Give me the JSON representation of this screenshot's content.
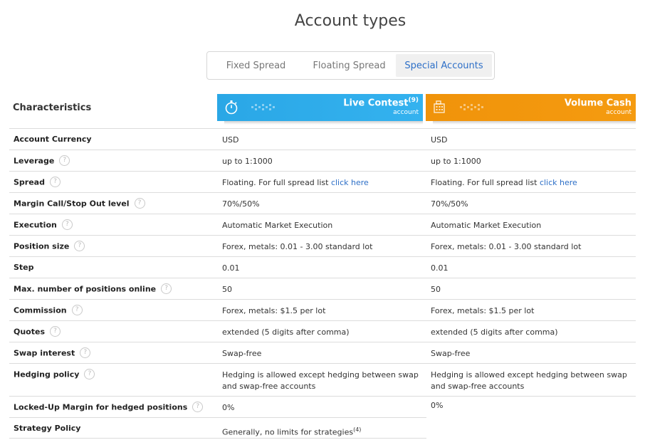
{
  "page_title": "Account types",
  "tabs": [
    {
      "label": "Fixed Spread"
    },
    {
      "label": "Floating Spread"
    },
    {
      "label": "Special Accounts"
    }
  ],
  "characteristics_title": "Characteristics",
  "accounts": [
    {
      "name": "Live Contest",
      "name_sup": "(9)",
      "subtitle": "account",
      "color": "#2aa7e6",
      "icon": "stopwatch-icon"
    },
    {
      "name": "Volume Cash",
      "name_sup": "",
      "subtitle": "account",
      "color": "#f0930a",
      "icon": "building-icon"
    }
  ],
  "rows": [
    {
      "label": "Account Currency",
      "help": false,
      "c1": "USD",
      "c2": "USD"
    },
    {
      "label": "Leverage",
      "help": true,
      "c1": "up to 1:1000",
      "c2": "up to 1:1000"
    },
    {
      "label": "Spread",
      "help": true,
      "c1": "Floating. For full spread list ",
      "c1_link": "click here",
      "c2": "Floating. For full spread list ",
      "c2_link": "click here"
    },
    {
      "label": "Margin Call/Stop Out level",
      "help": true,
      "c1": "70%/50%",
      "c2": "70%/50%"
    },
    {
      "label": "Execution",
      "help": true,
      "c1": "Automatic Market Execution",
      "c2": "Automatic Market Execution"
    },
    {
      "label": "Position size",
      "help": true,
      "c1": "Forex, metals: 0.01 - 3.00 standard lot",
      "c2": "Forex, metals: 0.01 - 3.00 standard lot"
    },
    {
      "label": "Step",
      "help": false,
      "c1": "0.01",
      "c2": "0.01"
    },
    {
      "label": "Max. number of positions online",
      "help": true,
      "c1": "50",
      "c2": "50"
    },
    {
      "label": "Commission",
      "help": true,
      "c1": "Forex, metals: $1.5 per lot",
      "c2": "Forex, metals: $1.5 per lot"
    },
    {
      "label": "Quotes",
      "help": true,
      "c1": "extended (5 digits after comma)",
      "c2": "extended (5 digits after comma)"
    },
    {
      "label": "Swap interest",
      "help": true,
      "c1": "Swap-free",
      "c2": "Swap-free"
    },
    {
      "label": "Hedging policy",
      "help": true,
      "c1": "Hedging is allowed except hedging between swap and swap-free accounts",
      "c2": "Hedging is allowed except hedging between swap and swap-free accounts"
    },
    {
      "label": "Locked-Up Margin for hedged positions",
      "help": true,
      "c1": "0%",
      "c2": "0%"
    },
    {
      "label": "Strategy Policy",
      "help": false,
      "c1": "Generally, no limits for strategies",
      "c1_sup": "(4)",
      "c2": ""
    }
  ],
  "help_glyph": "?"
}
